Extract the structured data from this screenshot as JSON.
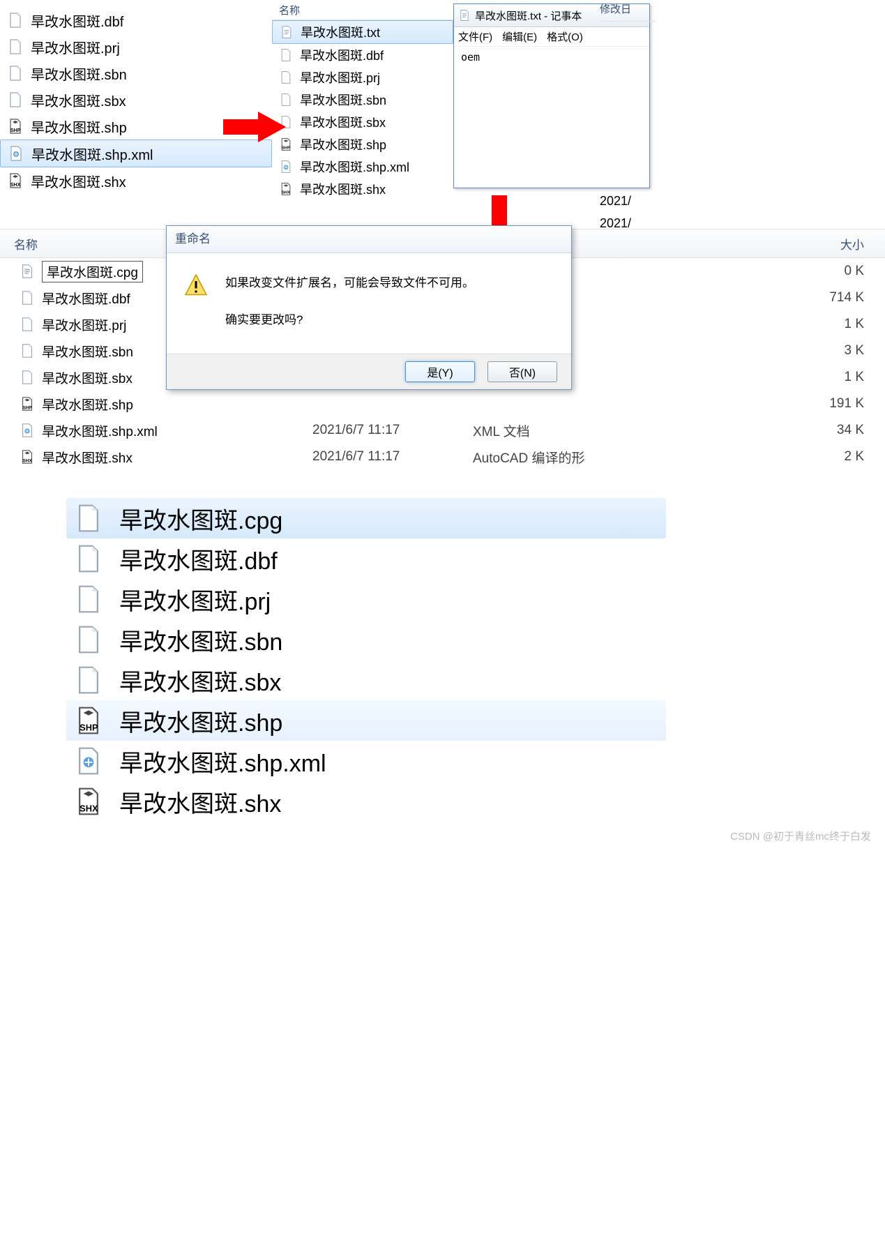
{
  "paneA": {
    "files": [
      {
        "name": "旱改水图斑.dbf",
        "icon": "file"
      },
      {
        "name": "旱改水图斑.prj",
        "icon": "file"
      },
      {
        "name": "旱改水图斑.sbn",
        "icon": "file"
      },
      {
        "name": "旱改水图斑.sbx",
        "icon": "file"
      },
      {
        "name": "旱改水图斑.shp",
        "icon": "shp"
      },
      {
        "name": "旱改水图斑.shp.xml",
        "icon": "xml",
        "selected": true
      },
      {
        "name": "旱改水图斑.shx",
        "icon": "shx"
      }
    ]
  },
  "paneB": {
    "header_name": "名称",
    "header_date": "修改日",
    "files": [
      {
        "name": "旱改水图斑.txt",
        "icon": "txt",
        "selected": true
      },
      {
        "name": "旱改水图斑.dbf",
        "icon": "file"
      },
      {
        "name": "旱改水图斑.prj",
        "icon": "file"
      },
      {
        "name": "旱改水图斑.sbn",
        "icon": "file"
      },
      {
        "name": "旱改水图斑.sbx",
        "icon": "file"
      },
      {
        "name": "旱改水图斑.shp",
        "icon": "shp"
      },
      {
        "name": "旱改水图斑.shp.xml",
        "icon": "xml"
      },
      {
        "name": "旱改水图斑.shx",
        "icon": "shx"
      }
    ],
    "date1": "2021/",
    "date2": "2021/"
  },
  "notepad": {
    "title": "旱改水图斑.txt - 记事本",
    "menu": [
      "文件(F)",
      "编辑(E)",
      "格式(O)"
    ],
    "content": "oem"
  },
  "explorer": {
    "cols": {
      "name": "名称",
      "date": "",
      "type": "",
      "size": "大小"
    },
    "rows": [
      {
        "name": "旱改水图斑.cpg",
        "icon": "txt",
        "editing": true,
        "size": "0 K"
      },
      {
        "name": "旱改水图斑.dbf",
        "icon": "file",
        "size": "714 K"
      },
      {
        "name": "旱改水图斑.prj",
        "icon": "file",
        "size": "1 K"
      },
      {
        "name": "旱改水图斑.sbn",
        "icon": "file",
        "size": "3 K"
      },
      {
        "name": "旱改水图斑.sbx",
        "icon": "file",
        "size": "1 K"
      },
      {
        "name": "旱改水图斑.shp",
        "icon": "shp",
        "size": "191 K"
      },
      {
        "name": "旱改水图斑.shp.xml",
        "icon": "xml",
        "date": "2021/6/7 11:17",
        "type": "XML 文档",
        "size": "34 K"
      },
      {
        "name": "旱改水图斑.shx",
        "icon": "shx",
        "date": "2021/6/7 11:17",
        "type": "AutoCAD 编译的形",
        "size": "2 K"
      }
    ]
  },
  "dialog": {
    "title": "重命名",
    "line1": "如果改变文件扩展名，可能会导致文件不可用。",
    "line2": "确实要更改吗?",
    "yes": "是(Y)",
    "no": "否(N)"
  },
  "biglist": {
    "rows": [
      {
        "name": "旱改水图斑.cpg",
        "icon": "file",
        "selected": true
      },
      {
        "name": "旱改水图斑.dbf",
        "icon": "file"
      },
      {
        "name": "旱改水图斑.prj",
        "icon": "file"
      },
      {
        "name": "旱改水图斑.sbn",
        "icon": "file"
      },
      {
        "name": "旱改水图斑.sbx",
        "icon": "file"
      },
      {
        "name": "旱改水图斑.shp",
        "icon": "shp",
        "hover": true
      },
      {
        "name": "旱改水图斑.shp.xml",
        "icon": "xml"
      },
      {
        "name": "旱改水图斑.shx",
        "icon": "shx"
      }
    ]
  },
  "watermark": "CSDN @初于青丝mc终于白发"
}
